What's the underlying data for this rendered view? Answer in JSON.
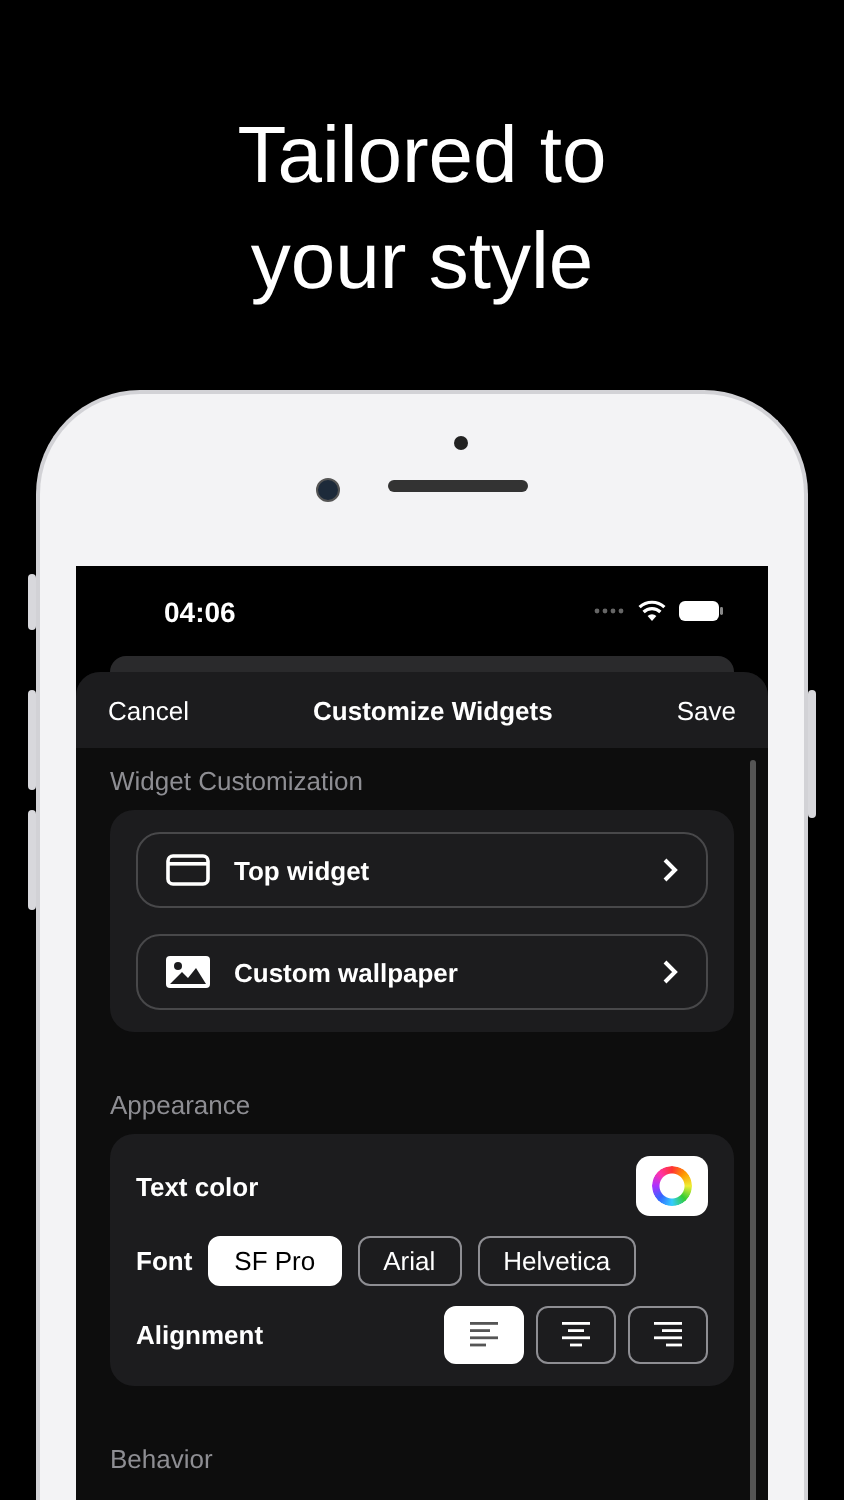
{
  "headline": {
    "lines": [
      "Tailored to",
      "your style"
    ]
  },
  "status_bar": {
    "time": "04:06"
  },
  "nav": {
    "cancel": "Cancel",
    "title": "Customize Widgets",
    "save": "Save"
  },
  "sections": [
    {
      "kind": "links",
      "title": "Widget Customization",
      "items": [
        {
          "kind": "widget",
          "label": "Top widget"
        },
        {
          "kind": "image",
          "label": "Custom wallpaper"
        }
      ]
    },
    {
      "kind": "appearance",
      "title": "Appearance",
      "text_color": {
        "label": "Text color"
      },
      "font": {
        "label": "Font",
        "options": [
          {
            "label": "SF Pro",
            "selected": true
          },
          {
            "label": "Arial",
            "selected": false
          },
          {
            "label": "Helvetica",
            "selected": false
          }
        ]
      },
      "alignment": {
        "label": "Alignment",
        "options": [
          {
            "kind": "left",
            "selected": true
          },
          {
            "kind": "center",
            "selected": false
          },
          {
            "kind": "right",
            "selected": false
          }
        ]
      }
    },
    {
      "kind": "header",
      "title": "Behavior"
    }
  ]
}
